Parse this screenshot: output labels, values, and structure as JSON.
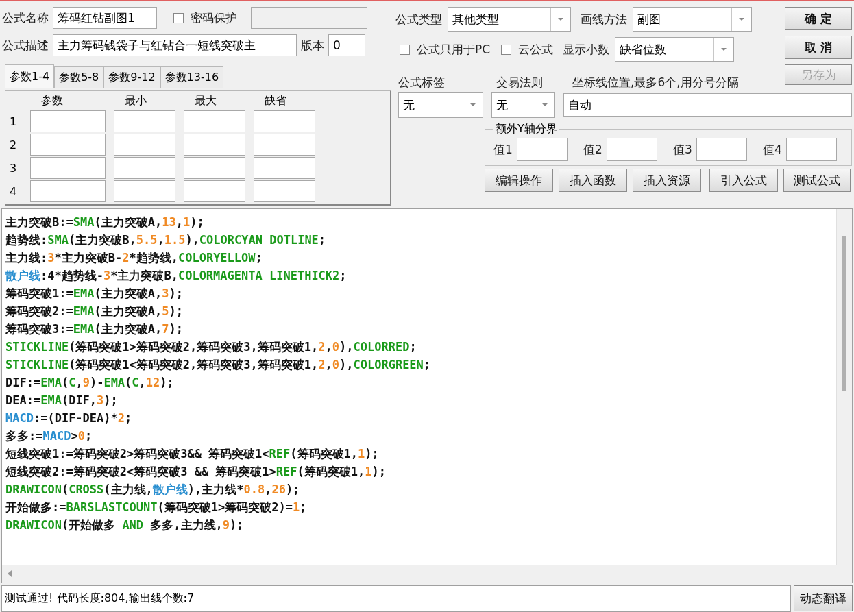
{
  "name_field": {
    "label": "公式名称",
    "value": "筹码红钻副图1"
  },
  "password": {
    "label": "密码保护",
    "checked": false,
    "field_disabled": true
  },
  "description_field": {
    "label": "公式描述",
    "value": "主力筹码钱袋子与红钻合一短线突破主"
  },
  "version_field": {
    "label": "版本",
    "value": "0"
  },
  "param_tabs": [
    {
      "label": "参数1-4",
      "selected": true
    },
    {
      "label": "参数5-8",
      "selected": false
    },
    {
      "label": "参数9-12",
      "selected": false
    },
    {
      "label": "参数13-16",
      "selected": false
    }
  ],
  "param_columns": [
    "参数",
    "最小",
    "最大",
    "缺省"
  ],
  "param_rows": [
    "1",
    "2",
    "3",
    "4"
  ],
  "formula_type": {
    "label": "公式类型",
    "value": "其他类型"
  },
  "draw_method": {
    "label": "画线方法",
    "value": "副图"
  },
  "options": [
    {
      "label": "公式只用于PC",
      "checked": false
    },
    {
      "label": "云公式",
      "checked": false
    }
  ],
  "decimals": {
    "label": "显示小数",
    "value": "缺省位数"
  },
  "side_buttons": [
    {
      "label": "确 定",
      "disabled": false
    },
    {
      "label": "取 消",
      "disabled": false
    },
    {
      "label": "另存为",
      "disabled": true
    }
  ],
  "formula_tag": {
    "label": "公式标签",
    "value": "无"
  },
  "trade_rule": {
    "label": "交易法则",
    "value": "无"
  },
  "axis_lines": {
    "label": "坐标线位置,最多6个,用分号分隔",
    "value": "自动"
  },
  "y_axis_group": {
    "title": "额外Y轴分界",
    "fields": [
      "值1",
      "值2",
      "值3",
      "值4"
    ]
  },
  "action_buttons": [
    "编辑操作",
    "插入函数",
    "插入资源",
    "引入公式",
    "测试公式"
  ],
  "code_lines": [
    [
      {
        "kind": "plain",
        "text": "主力突破B:="
      },
      {
        "kind": "func",
        "text": "SMA"
      },
      {
        "kind": "plain",
        "text": "(主力突破A,"
      },
      {
        "kind": "number",
        "text": "13"
      },
      {
        "kind": "plain",
        "text": ","
      },
      {
        "kind": "number",
        "text": "1"
      },
      {
        "kind": "plain",
        "text": ");"
      }
    ],
    [
      {
        "kind": "plain",
        "text": "趋势线:"
      },
      {
        "kind": "func",
        "text": "SMA"
      },
      {
        "kind": "plain",
        "text": "(主力突破B,"
      },
      {
        "kind": "number",
        "text": "5.5"
      },
      {
        "kind": "plain",
        "text": ","
      },
      {
        "kind": "number",
        "text": "1.5"
      },
      {
        "kind": "plain",
        "text": "),"
      },
      {
        "kind": "func",
        "text": "COLORCYAN DOTLINE"
      },
      {
        "kind": "plain",
        "text": ";"
      }
    ],
    [
      {
        "kind": "plain",
        "text": "主力线:"
      },
      {
        "kind": "number",
        "text": "3"
      },
      {
        "kind": "plain",
        "text": "*主力突破B-"
      },
      {
        "kind": "number",
        "text": "2"
      },
      {
        "kind": "plain",
        "text": "*趋势线,"
      },
      {
        "kind": "func",
        "text": "COLORYELLOW"
      },
      {
        "kind": "plain",
        "text": ";"
      }
    ],
    [
      {
        "kind": "variable",
        "text": "散户线"
      },
      {
        "kind": "plain",
        "text": ":4*趋势线-"
      },
      {
        "kind": "number",
        "text": "3"
      },
      {
        "kind": "plain",
        "text": "*主力突破B,"
      },
      {
        "kind": "func",
        "text": "COLORMAGENTA LINETHICK2"
      },
      {
        "kind": "plain",
        "text": ";"
      }
    ],
    [
      {
        "kind": "plain",
        "text": "筹码突破1:="
      },
      {
        "kind": "func",
        "text": "EMA"
      },
      {
        "kind": "plain",
        "text": "(主力突破A,"
      },
      {
        "kind": "number",
        "text": "3"
      },
      {
        "kind": "plain",
        "text": ");"
      }
    ],
    [
      {
        "kind": "plain",
        "text": "筹码突破2:="
      },
      {
        "kind": "func",
        "text": "EMA"
      },
      {
        "kind": "plain",
        "text": "(主力突破A,"
      },
      {
        "kind": "number",
        "text": "5"
      },
      {
        "kind": "plain",
        "text": ");"
      }
    ],
    [
      {
        "kind": "plain",
        "text": "筹码突破3:="
      },
      {
        "kind": "func",
        "text": "EMA"
      },
      {
        "kind": "plain",
        "text": "(主力突破A,"
      },
      {
        "kind": "number",
        "text": "7"
      },
      {
        "kind": "plain",
        "text": ");"
      }
    ],
    [
      {
        "kind": "func",
        "text": "STICKLINE"
      },
      {
        "kind": "plain",
        "text": "(筹码突破1>筹码突破2,筹码突破3,筹码突破1,"
      },
      {
        "kind": "number",
        "text": "2"
      },
      {
        "kind": "plain",
        "text": ","
      },
      {
        "kind": "number",
        "text": "0"
      },
      {
        "kind": "plain",
        "text": "),"
      },
      {
        "kind": "func",
        "text": "COLORRED"
      },
      {
        "kind": "plain",
        "text": ";"
      }
    ],
    [
      {
        "kind": "func",
        "text": "STICKLINE"
      },
      {
        "kind": "plain",
        "text": "(筹码突破1<筹码突破2,筹码突破3,筹码突破1,"
      },
      {
        "kind": "number",
        "text": "2"
      },
      {
        "kind": "plain",
        "text": ","
      },
      {
        "kind": "number",
        "text": "0"
      },
      {
        "kind": "plain",
        "text": "),"
      },
      {
        "kind": "func",
        "text": "COLORGREEN"
      },
      {
        "kind": "plain",
        "text": ";"
      }
    ],
    [
      {
        "kind": "plain",
        "text": "DIF:="
      },
      {
        "kind": "func",
        "text": "EMA"
      },
      {
        "kind": "plain",
        "text": "("
      },
      {
        "kind": "func",
        "text": "C"
      },
      {
        "kind": "plain",
        "text": ","
      },
      {
        "kind": "number",
        "text": "9"
      },
      {
        "kind": "plain",
        "text": ")-"
      },
      {
        "kind": "func",
        "text": "EMA"
      },
      {
        "kind": "plain",
        "text": "("
      },
      {
        "kind": "func",
        "text": "C"
      },
      {
        "kind": "plain",
        "text": ","
      },
      {
        "kind": "number",
        "text": "12"
      },
      {
        "kind": "plain",
        "text": ");"
      }
    ],
    [
      {
        "kind": "plain",
        "text": "DEA:="
      },
      {
        "kind": "func",
        "text": "EMA"
      },
      {
        "kind": "plain",
        "text": "(DIF,"
      },
      {
        "kind": "number",
        "text": "3"
      },
      {
        "kind": "plain",
        "text": ");"
      }
    ],
    [
      {
        "kind": "variable",
        "text": "MACD"
      },
      {
        "kind": "plain",
        "text": ":=(DIF-DEA)*"
      },
      {
        "kind": "number",
        "text": "2"
      },
      {
        "kind": "plain",
        "text": ";"
      }
    ],
    [
      {
        "kind": "plain",
        "text": "多多:="
      },
      {
        "kind": "variable",
        "text": "MACD"
      },
      {
        "kind": "plain",
        "text": ">"
      },
      {
        "kind": "number",
        "text": "0"
      },
      {
        "kind": "plain",
        "text": ";"
      }
    ],
    [
      {
        "kind": "plain",
        "text": "短线突破1:=筹码突破2>筹码突破3&& 筹码突破1<"
      },
      {
        "kind": "func",
        "text": "REF"
      },
      {
        "kind": "plain",
        "text": "(筹码突破1,"
      },
      {
        "kind": "number",
        "text": "1"
      },
      {
        "kind": "plain",
        "text": ");"
      }
    ],
    [
      {
        "kind": "plain",
        "text": "短线突破2:=筹码突破2<筹码突破3 && 筹码突破1>"
      },
      {
        "kind": "func",
        "text": "REF"
      },
      {
        "kind": "plain",
        "text": "(筹码突破1,"
      },
      {
        "kind": "number",
        "text": "1"
      },
      {
        "kind": "plain",
        "text": ");"
      }
    ],
    [
      {
        "kind": "func",
        "text": "DRAWICON"
      },
      {
        "kind": "plain",
        "text": "("
      },
      {
        "kind": "func",
        "text": "CROSS"
      },
      {
        "kind": "plain",
        "text": "(主力线,"
      },
      {
        "kind": "variable",
        "text": "散户线"
      },
      {
        "kind": "plain",
        "text": "),主力线*"
      },
      {
        "kind": "number",
        "text": "0.8"
      },
      {
        "kind": "plain",
        "text": ","
      },
      {
        "kind": "number",
        "text": "26"
      },
      {
        "kind": "plain",
        "text": ");"
      }
    ],
    [
      {
        "kind": "plain",
        "text": "开始做多:="
      },
      {
        "kind": "func",
        "text": "BARSLASTCOUNT"
      },
      {
        "kind": "plain",
        "text": "(筹码突破1>筹码突破2)="
      },
      {
        "kind": "number",
        "text": "1"
      },
      {
        "kind": "plain",
        "text": ";"
      }
    ],
    [
      {
        "kind": "func",
        "text": "DRAWICON"
      },
      {
        "kind": "plain",
        "text": "(开始做多 "
      },
      {
        "kind": "func",
        "text": "AND"
      },
      {
        "kind": "plain",
        "text": " 多多,主力线,"
      },
      {
        "kind": "number",
        "text": "9"
      },
      {
        "kind": "plain",
        "text": ");"
      }
    ]
  ],
  "status": {
    "message": "测试通过! 代码长度:804,输出线个数:7",
    "button": "动态翻译"
  }
}
